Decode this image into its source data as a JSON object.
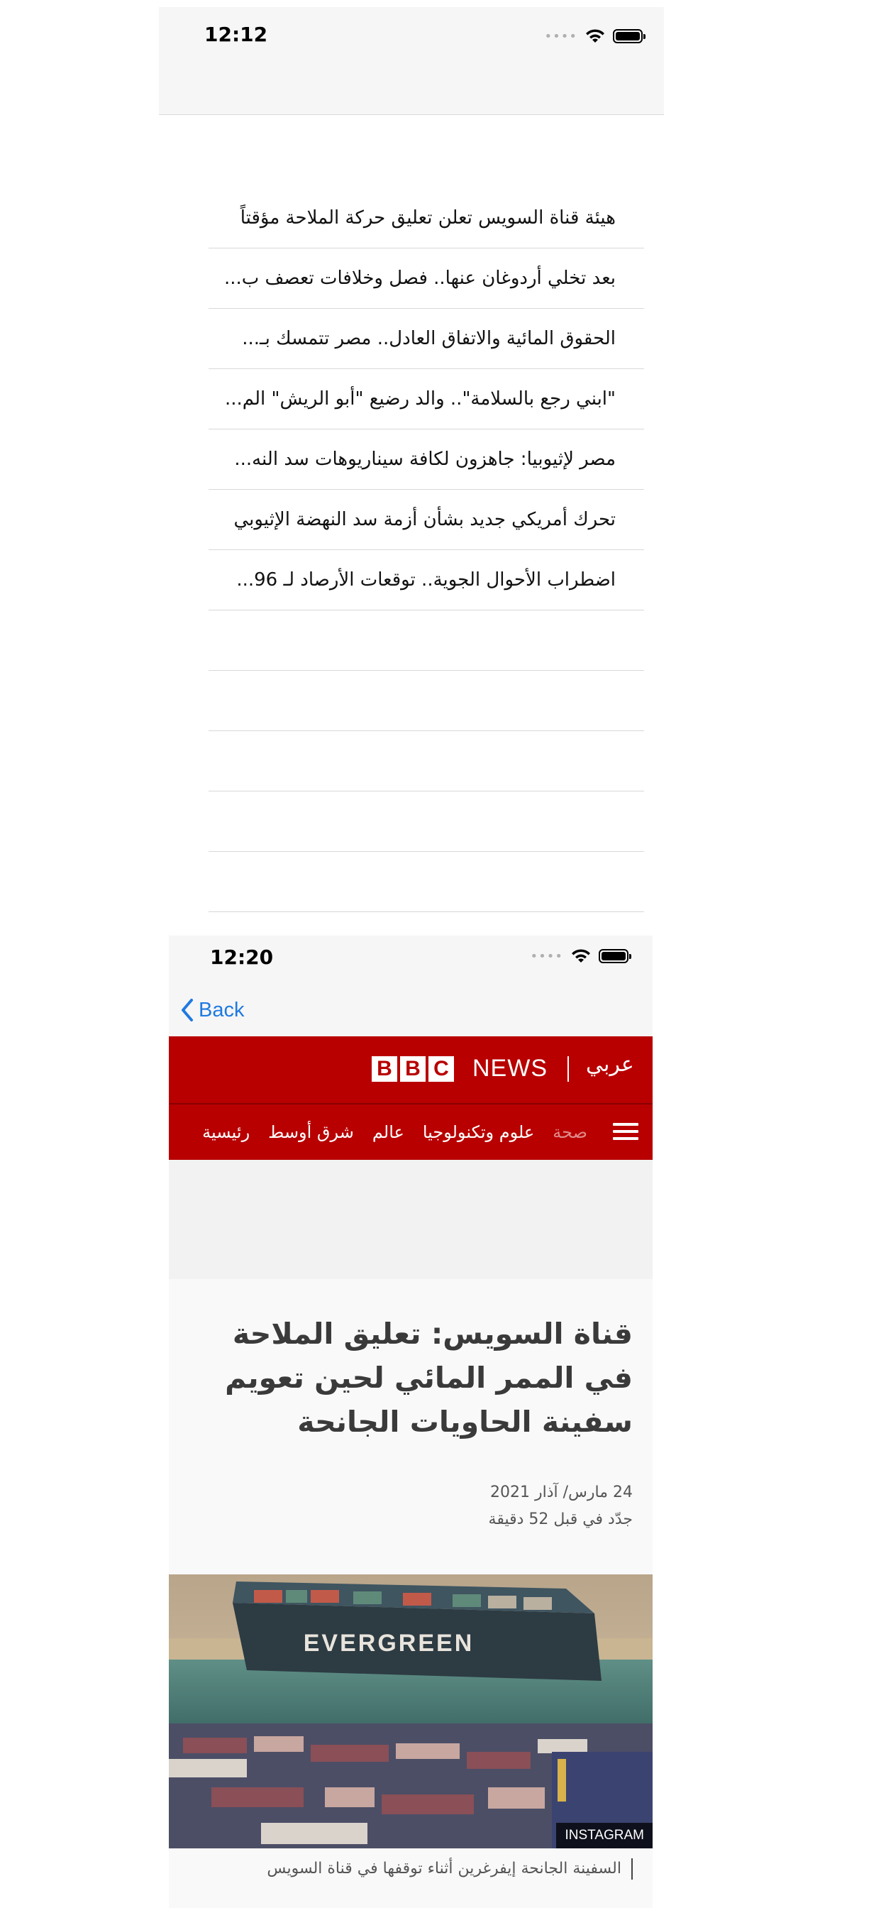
{
  "screen1": {
    "status_time": "12:12",
    "headlines": [
      "هيئة قناة السويس تعلن تعليق حركة الملاحة مؤقتاً",
      "بعد تخلي أردوغان عنها.. فصل وخلافات تعصف ب...",
      "الحقوق المائية والاتفاق العادل.. مصر تتمسك بـ...",
      "\"ابني رجع بالسلامة\".. والد رضيع \"أبو الريش\" الم...",
      "مصر لإثيوبيا: جاهزون لكافة سيناريوهات سد النه...",
      "تحرك أمريكي جديد بشأن أزمة سد النهضة الإثيوبي",
      "اضطراب الأحوال الجوية.. توقعات الأرصاد لـ 96...",
      "",
      "",
      "",
      "",
      ""
    ]
  },
  "screen2": {
    "status_time": "12:20",
    "back_label": "Back",
    "brand": {
      "bbc_letters": [
        "B",
        "B",
        "C"
      ],
      "news": "NEWS",
      "arabic": "عربي",
      "red": "#b80000"
    },
    "nav_items": [
      "رئيسية",
      "شرق أوسط",
      "عالم",
      "علوم وتكنولوجيا",
      "صحة"
    ],
    "article": {
      "title": "قناة السويس: تعليق الملاحة في الممر المائي لحين تعويم سفينة الحاويات الجانحة",
      "date": "24 مارس/ آذار 2021",
      "updated": "جدّد في قبل 52 دقيقة",
      "image_text": "EVERGREEN",
      "image_credit": "INSTAGRAM",
      "caption": "السفينة الجانحة إيفرغرين أثناء توقفها في قناة السويس"
    }
  },
  "colors": {
    "link_blue": "#1f7ae0",
    "separator": "#d8d8d8"
  }
}
